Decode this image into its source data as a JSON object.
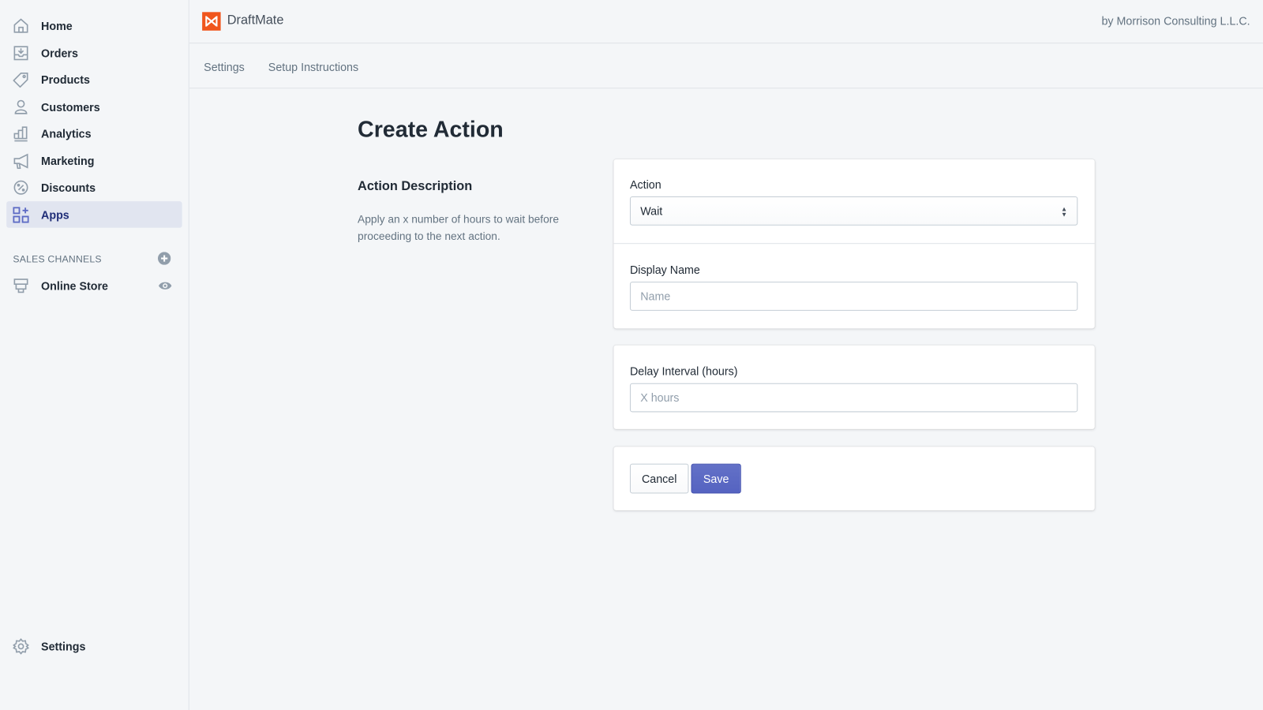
{
  "sidebar": {
    "items": [
      {
        "label": "Home",
        "icon": "home-icon"
      },
      {
        "label": "Orders",
        "icon": "orders-icon"
      },
      {
        "label": "Products",
        "icon": "tag-icon"
      },
      {
        "label": "Customers",
        "icon": "person-icon"
      },
      {
        "label": "Analytics",
        "icon": "bar-chart-icon"
      },
      {
        "label": "Marketing",
        "icon": "megaphone-icon"
      },
      {
        "label": "Discounts",
        "icon": "discount-icon"
      },
      {
        "label": "Apps",
        "icon": "apps-icon",
        "active": true
      }
    ],
    "sales_channels_title": "SALES CHANNELS",
    "online_store": "Online Store",
    "settings": "Settings"
  },
  "header": {
    "app_name": "DraftMate",
    "byline": "by Morrison Consulting L.L.C.",
    "brand_color": "#f0561d"
  },
  "tabs": [
    "Settings",
    "Setup Instructions"
  ],
  "main": {
    "title": "Create Action",
    "description_title": "Action Description",
    "description": "Apply an x number of hours to wait before proceeding to the next action.",
    "action_label": "Action",
    "action_value": "Wait",
    "display_name_label": "Display Name",
    "display_name_placeholder": "Name",
    "delay_label": "Delay Interval (hours)",
    "delay_placeholder": "X hours",
    "cancel": "Cancel",
    "save": "Save",
    "accent_color": "#5c6ac4"
  }
}
